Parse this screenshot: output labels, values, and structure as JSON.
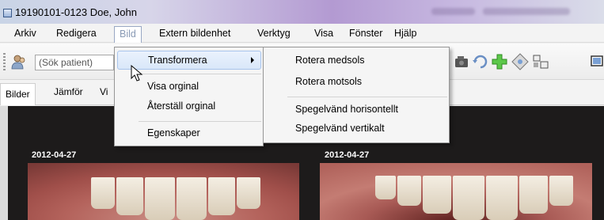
{
  "window": {
    "title": "19190101-0123 Doe, John"
  },
  "menubar": {
    "items": [
      "Arkiv",
      "Redigera",
      "Bild",
      "Extern bildenhet",
      "Verktyg",
      "Visa",
      "Fönster",
      "Hjälp"
    ],
    "active": "Bild"
  },
  "toolbar": {
    "search_placeholder": "(Sök patient)"
  },
  "tabs": {
    "items": [
      "Bilder",
      "Jämför",
      "Vi"
    ]
  },
  "bild_menu": {
    "items": [
      "Transformera",
      "Visa orginal",
      "Återställ orginal",
      "Egenskaper"
    ],
    "highlighted": "Transformera"
  },
  "transform_submenu": {
    "items": [
      "Rotera medsols",
      "Rotera motsols",
      "Spegelvänd horisontellt",
      "Spegelvänd vertikalt"
    ]
  },
  "photos": [
    {
      "date": "2012-04-27"
    },
    {
      "date": "2012-04-27"
    }
  ]
}
